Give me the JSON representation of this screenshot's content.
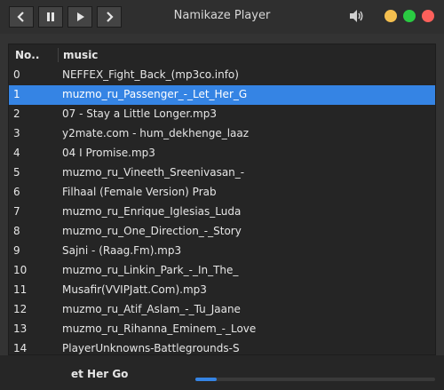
{
  "window": {
    "title": "Namikaze Player"
  },
  "controls": [
    {
      "name": "previous-button",
      "icon": "chevron-left-icon"
    },
    {
      "name": "pause-button",
      "icon": "pause-icon"
    },
    {
      "name": "play-button",
      "icon": "play-icon"
    },
    {
      "name": "next-button",
      "icon": "chevron-right-icon"
    }
  ],
  "volume_icon": "speaker-icon",
  "traffic_lights": {
    "minimize": "#f4bf4f",
    "maximize": "#2acb42",
    "close": "#fc605b"
  },
  "colors": {
    "accent": "#3584e4"
  },
  "list": {
    "headers": {
      "number": "No..",
      "music": "music"
    },
    "selected_index": 1,
    "rows": [
      {
        "no": "0",
        "music": "NEFFEX_Fight_Back_(mp3co.info)"
      },
      {
        "no": "1",
        "music": "muzmo_ru_Passenger_-_Let_Her_G"
      },
      {
        "no": "2",
        "music": "07 - Stay a Little Longer.mp3"
      },
      {
        "no": "3",
        "music": "y2mate.com - hum_dekhenge_laaz"
      },
      {
        "no": "4",
        "music": "04 I Promise.mp3"
      },
      {
        "no": "5",
        "music": "muzmo_ru_Vineeth_Sreenivasan_-"
      },
      {
        "no": "6",
        "music": "Filhaal (Female Version)  Prab"
      },
      {
        "no": "7",
        "music": "muzmo_ru_Enrique_Iglesias_Luda"
      },
      {
        "no": "8",
        "music": "muzmo_ru_One_Direction_-_Story"
      },
      {
        "no": "9",
        "music": "Sajni - (Raag.Fm).mp3"
      },
      {
        "no": "10",
        "music": "muzmo_ru_Linkin_Park_-_In_The_"
      },
      {
        "no": "11",
        "music": "Musafir(VVIPJatt.Com).mp3"
      },
      {
        "no": "12",
        "music": "muzmo_ru_Atif_Aslam_-_Tu_Jaane"
      },
      {
        "no": "13",
        "music": "muzmo_ru_Rihanna_Eminem_-_Love"
      },
      {
        "no": "14",
        "music": "PlayerUnknowns-Battlegrounds-S"
      }
    ]
  },
  "now_playing": {
    "text": "et Her Go",
    "progress": 0.09
  }
}
